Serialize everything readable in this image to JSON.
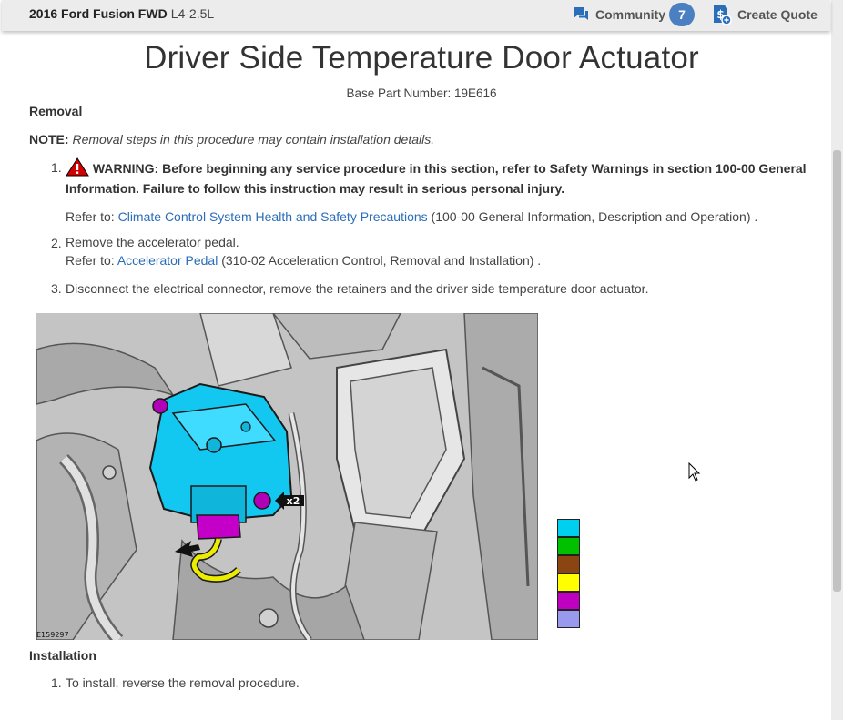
{
  "header": {
    "vehicle_name": "2016 Ford Fusion FWD",
    "engine": "L4-2.5L",
    "community_label": "Community",
    "community_count": "7",
    "quote_label": "Create Quote"
  },
  "page": {
    "title": "Driver Side Temperature Door Actuator",
    "base_part": "Base Part Number: 19E616"
  },
  "removal": {
    "heading": "Removal",
    "note_label": "NOTE:",
    "note_text": "Removal steps in this procedure may contain installation details.",
    "steps": [
      {
        "num": "1.",
        "warning_line1": "WARNING: Before beginning any service procedure in this section, refer to Safety Warnings in section 100-00 General",
        "warning_line2": "Information. Failure to follow this instruction may result in serious personal injury.",
        "refer_prefix": "Refer to:",
        "refer_link": "Climate Control System Health and Safety Precautions",
        "refer_suffix": "(100-00 General Information, Description and Operation) ."
      },
      {
        "num": "2.",
        "text": "Remove the accelerator pedal.",
        "refer_prefix": "Refer to:",
        "refer_link": "Accelerator Pedal",
        "refer_suffix": "(310-02 Acceleration Control, Removal and Installation) ."
      },
      {
        "num": "3.",
        "text": "Disconnect the electrical connector, remove the retainers and the driver side temperature door actuator."
      }
    ]
  },
  "diagram": {
    "figure_id": "E159297",
    "callout": "x2"
  },
  "legend": {
    "colors": [
      "#00d0f0",
      "#00c000",
      "#8b4513",
      "#ffff00",
      "#c000c0",
      "#9999ee"
    ]
  },
  "installation": {
    "heading": "Installation",
    "steps": [
      {
        "num": "1.",
        "text": "To install, reverse the removal procedure."
      }
    ]
  }
}
